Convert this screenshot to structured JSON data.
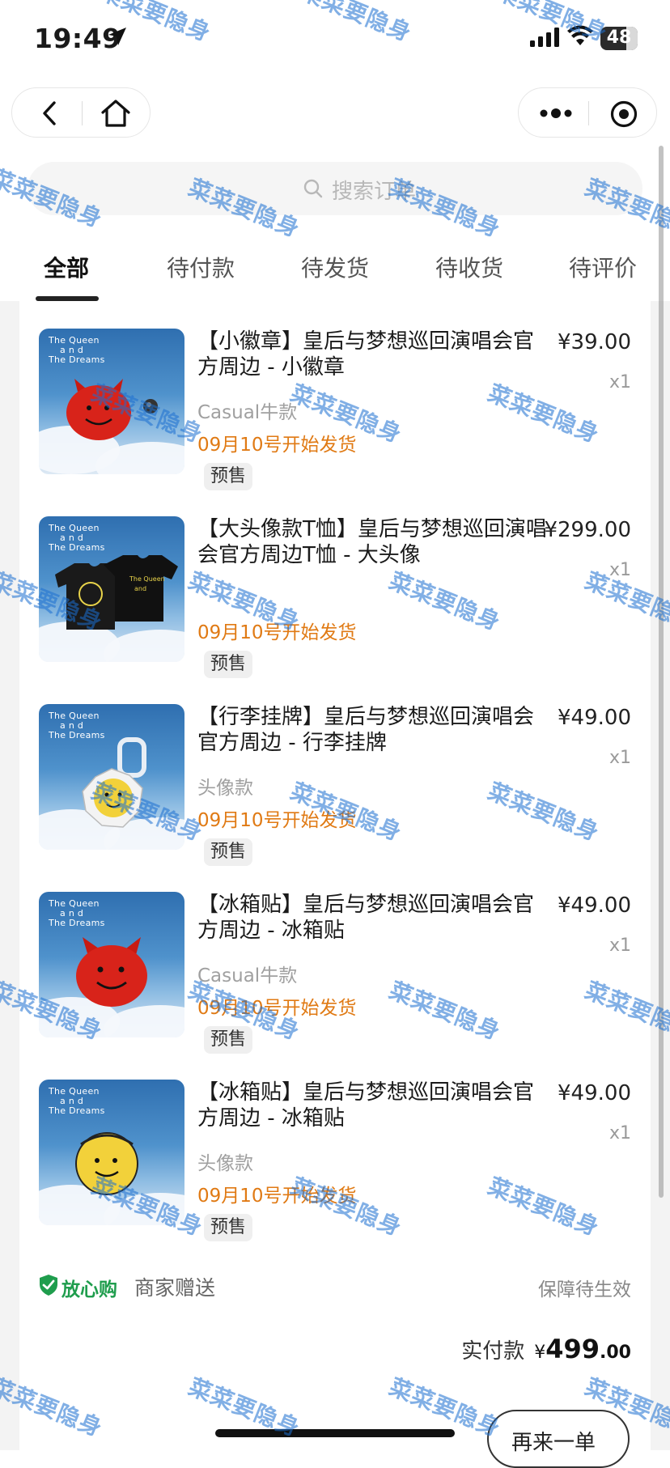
{
  "status_bar": {
    "time": "19:49",
    "battery": "48"
  },
  "search": {
    "placeholder": "搜索订单"
  },
  "tabs": [
    "全部",
    "待付款",
    "待发货",
    "待收货",
    "待评价"
  ],
  "thumbnail_caption": [
    "The Queen",
    "a n d",
    "The Dreams"
  ],
  "items": [
    {
      "title": "【小徽章】皇后与梦想巡回演唱会官方周边 - 小徽章",
      "variant": "Casual牛款",
      "price": "¥39.00",
      "qty": "x1",
      "ship": "09月10号开始发货",
      "badge": "预售",
      "art": "red-devil-pin"
    },
    {
      "title": "【大头像款T恤】皇后与梦想巡回演唱会官方周边T恤 - 大头像",
      "variant": "",
      "price": "¥299.00",
      "qty": "x1",
      "ship": "09月10号开始发货",
      "badge": "预售",
      "art": "black-tshirts"
    },
    {
      "title": "【行李挂牌】皇后与梦想巡回演唱会官方周边 - 行李挂牌",
      "variant": "头像款",
      "price": "¥49.00",
      "qty": "x1",
      "ship": "09月10号开始发货",
      "badge": "预售",
      "art": "chris-lee-tag"
    },
    {
      "title": "【冰箱贴】皇后与梦想巡回演唱会官方周边 - 冰箱贴",
      "variant": "Casual牛款",
      "price": "¥49.00",
      "qty": "x1",
      "ship": "09月10号开始发货",
      "badge": "预售",
      "art": "red-devil-magnet"
    },
    {
      "title": "【冰箱贴】皇后与梦想巡回演唱会官方周边 - 冰箱贴",
      "variant": "头像款",
      "price": "¥49.00",
      "qty": "x1",
      "ship": "09月10号开始发货",
      "badge": "预售",
      "art": "chris-lee-magnet"
    }
  ],
  "assurance": {
    "label": "放心购",
    "gift": "商家赠送",
    "status": "保障待生效"
  },
  "payment": {
    "label": "实付款",
    "currency": "¥",
    "amount_int": "499",
    "amount_dec": ".00"
  },
  "rebuy_button": "再来一单",
  "watermark": "菜菜要隐身",
  "colors": {
    "ship_orange": "#e07a14",
    "assure_green": "#1f9d4d",
    "watermark_blue": "#1b6fd1"
  }
}
